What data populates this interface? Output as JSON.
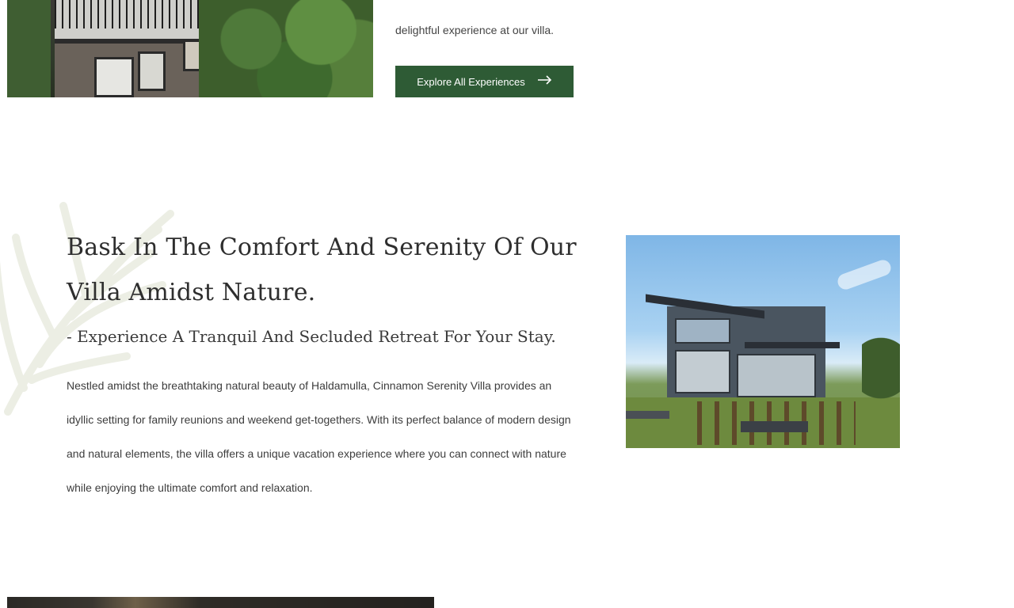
{
  "top_section": {
    "paragraph_tail": "delightful experience at our villa.",
    "button_label": "Explore All Experiences",
    "button_icon": "arrow-right-icon"
  },
  "intro_section": {
    "headline": "Bask In The Comfort And Serenity Of Our Villa Amidst Nature.",
    "subheadline": "- Experience A Tranquil And Secluded Retreat For Your Stay.",
    "body": "Nestled amidst the breathtaking natural beauty of Haldamulla, Cinnamon Serenity Villa provides an idyllic setting for family reunions and weekend get-togethers. With its perfect balance of modern design and natural elements, the villa offers a unique vacation experience where you can connect with nature while enjoying the ultimate comfort and relaxation."
  },
  "colors": {
    "accent": "#2e5b35",
    "text": "#333333",
    "background": "#ffffff"
  }
}
